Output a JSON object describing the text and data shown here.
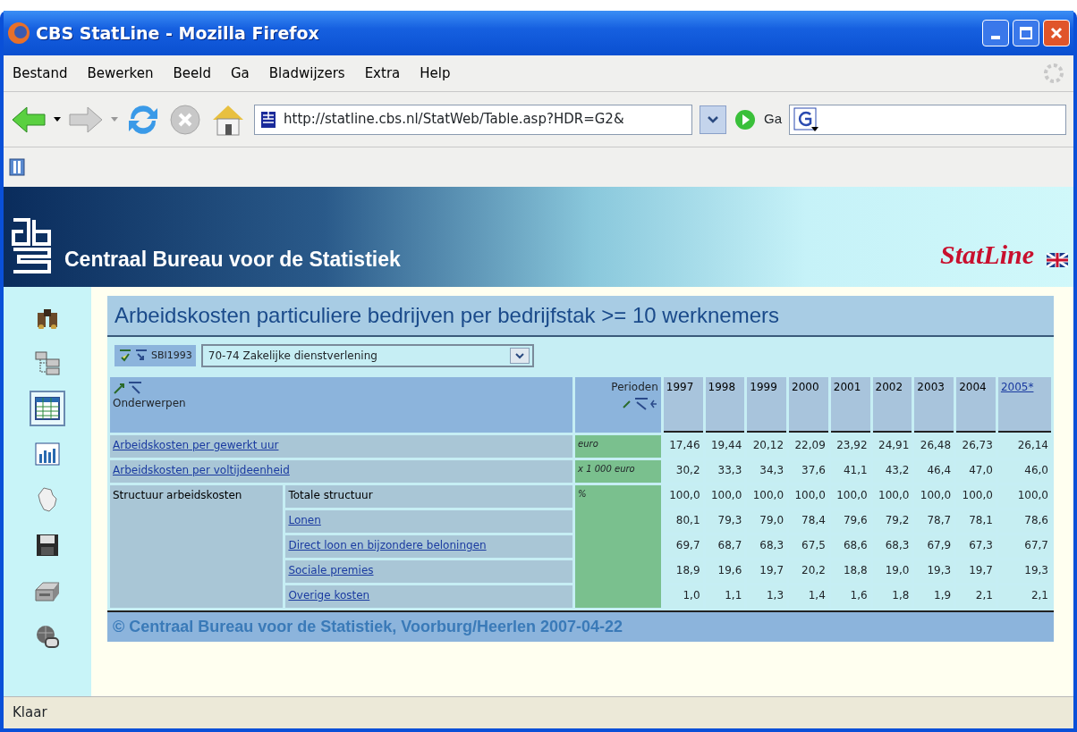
{
  "window": {
    "title": "CBS StatLine - Mozilla Firefox"
  },
  "menu": [
    {
      "label": "Bestand"
    },
    {
      "label": "Bewerken"
    },
    {
      "label": "Beeld"
    },
    {
      "label": "Ga"
    },
    {
      "label": "Bladwijzers"
    },
    {
      "label": "Extra"
    },
    {
      "label": "Help"
    }
  ],
  "toolbar": {
    "address": "http://statline.cbs.nl/StatWeb/Table.asp?HDR=G2&",
    "go_label": "Ga"
  },
  "header": {
    "org_name": "Centraal Bureau voor de Statistiek",
    "brand": "StatLine"
  },
  "tools": [
    {
      "kind": "search",
      "selected": false
    },
    {
      "kind": "tree",
      "selected": false
    },
    {
      "kind": "table",
      "selected": true
    },
    {
      "kind": "chart",
      "selected": false
    },
    {
      "kind": "map",
      "selected": false
    },
    {
      "kind": "save",
      "selected": false
    },
    {
      "kind": "print",
      "selected": false
    },
    {
      "kind": "globe",
      "selected": false
    }
  ],
  "table": {
    "title": "Arbeidskosten particuliere bedrijven per bedrijfstak >= 10 werknemers",
    "filter": {
      "dimension": "SBI1993",
      "value": "70-74 Zakelijke dienstverlening"
    },
    "row_header": "Onderwerpen",
    "column_header": "Perioden",
    "columns": [
      {
        "label": "1997",
        "link": false
      },
      {
        "label": "1998",
        "link": false
      },
      {
        "label": "1999",
        "link": false
      },
      {
        "label": "2000",
        "link": false
      },
      {
        "label": "2001",
        "link": false
      },
      {
        "label": "2002",
        "link": false
      },
      {
        "label": "2003",
        "link": false
      },
      {
        "label": "2004",
        "link": false
      },
      {
        "label": "2005*",
        "link": true
      }
    ],
    "rows": [
      {
        "kind": "item",
        "label": "Arbeidskosten per gewerkt uur",
        "link": true,
        "unit": "euro",
        "values": [
          "17,46",
          "19,44",
          "20,12",
          "22,09",
          "23,92",
          "24,91",
          "26,48",
          "26,73",
          "26,14"
        ]
      },
      {
        "kind": "item",
        "label": "Arbeidskosten per voltijdeenheid",
        "link": true,
        "unit": "x 1 000 euro",
        "values": [
          "30,2",
          "33,3",
          "34,3",
          "37,6",
          "41,1",
          "43,2",
          "46,4",
          "47,0",
          "46,0"
        ]
      },
      {
        "kind": "group",
        "label": "Structuur arbeidskosten",
        "unit": "%",
        "children": [
          {
            "label": "Totale structuur",
            "link": false,
            "values": [
              "100,0",
              "100,0",
              "100,0",
              "100,0",
              "100,0",
              "100,0",
              "100,0",
              "100,0",
              "100,0"
            ]
          },
          {
            "label": "Lonen",
            "link": true,
            "values": [
              "80,1",
              "79,3",
              "79,0",
              "78,4",
              "79,6",
              "79,2",
              "78,7",
              "78,1",
              "78,6"
            ]
          },
          {
            "label": "Direct loon en bijzondere beloningen",
            "link": true,
            "values": [
              "69,7",
              "68,7",
              "68,3",
              "67,5",
              "68,6",
              "68,3",
              "67,9",
              "67,3",
              "67,7"
            ]
          },
          {
            "label": "Sociale premies",
            "link": true,
            "values": [
              "18,9",
              "19,6",
              "19,7",
              "20,2",
              "18,8",
              "19,0",
              "19,3",
              "19,7",
              "19,3"
            ]
          },
          {
            "label": "Overige kosten",
            "link": true,
            "values": [
              "1,0",
              "1,1",
              "1,3",
              "1,4",
              "1,6",
              "1,8",
              "1,9",
              "2,1",
              "2,1"
            ]
          }
        ]
      }
    ],
    "footer": "© Centraal Bureau voor de Statistiek, Voorburg/Heerlen 2007-04-22"
  },
  "status_bar": "Klaar"
}
